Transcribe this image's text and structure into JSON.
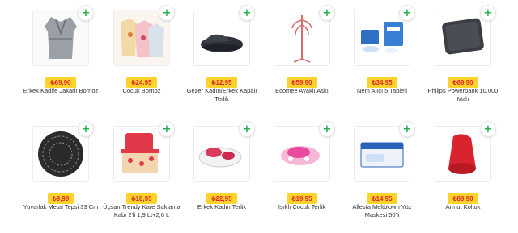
{
  "products": [
    {
      "name": "Erkek Kadife Jakarlı Bornoz",
      "price": "₺69,90",
      "image": "bathrobe"
    },
    {
      "name": "Çocuk Bornoz",
      "price": "₺24,95",
      "image": "kids-bathrobes"
    },
    {
      "name": "Gezer Kadın/Erkek Kapalı Terlik",
      "price": "₺12,95",
      "image": "slipper"
    },
    {
      "name": "Ecomee Ayaklı Askı",
      "price": "₺59,90",
      "image": "coat-rack"
    },
    {
      "name": "Nem Alıcı 5 Tableti",
      "price": "₺34,95",
      "image": "dehumidifier-tablets"
    },
    {
      "name": "Philips Powerbank 10.000 Mah",
      "price": "₺69,90",
      "image": "powerbank"
    },
    {
      "name": "Yuvarlak Metal Tepsi 33 Cm",
      "price": "₺9,99",
      "image": "round-tray"
    },
    {
      "name": "Üçsan Trendy Kare Saklama Kabı 2'li 1,9 Lt+2,6 L",
      "price": "₺18,95",
      "image": "storage-boxes"
    },
    {
      "name": "Erkek Kadın Terlik",
      "price": "₺22,95",
      "image": "clog-white"
    },
    {
      "name": "Işıklı Çocuk Terlik",
      "price": "₺19,95",
      "image": "clog-pink"
    },
    {
      "name": "Allesta Meltblown Yüz Maskesi 50'li",
      "price": "₺14,95",
      "image": "face-mask-box"
    },
    {
      "name": "Armut Koltuk",
      "price": "₺89,90",
      "image": "bean-bag"
    }
  ],
  "add_button_label": "+",
  "colors": {
    "price_bg": "#ffd32a",
    "price_text": "#e0282d",
    "add_icon": "#27b14a"
  }
}
